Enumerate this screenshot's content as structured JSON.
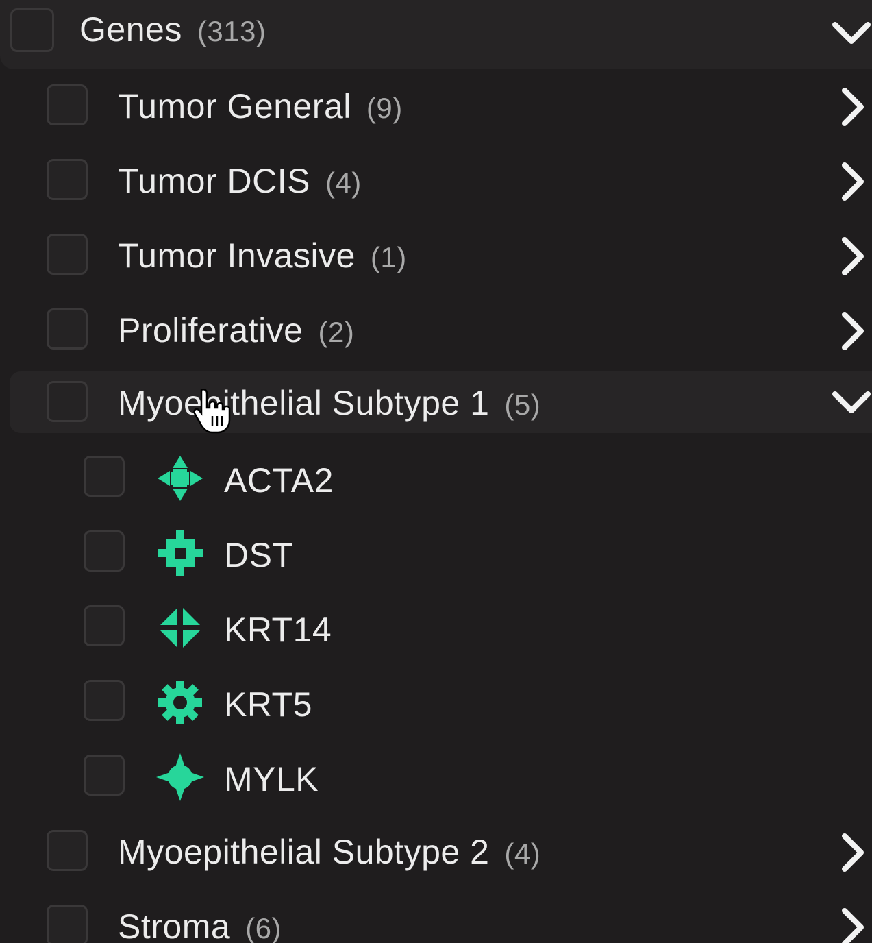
{
  "root": {
    "label": "Genes",
    "count": "(313)"
  },
  "groups": [
    {
      "label": "Tumor General",
      "count": "(9)"
    },
    {
      "label": "Tumor DCIS",
      "count": "(4)"
    },
    {
      "label": "Tumor Invasive",
      "count": "(1)"
    },
    {
      "label": "Proliferative",
      "count": "(2)"
    },
    {
      "label": "Myoepithelial Subtype 1",
      "count": "(5)"
    },
    {
      "label": "Myoepithelial Subtype 2",
      "count": "(4)"
    },
    {
      "label": "Stroma",
      "count": "(6)"
    }
  ],
  "genes": [
    {
      "label": "ACTA2",
      "icon": "four-arrows-marker-icon"
    },
    {
      "label": "DST",
      "icon": "square-cross-marker-icon"
    },
    {
      "label": "KRT14",
      "icon": "split-diamond-marker-icon"
    },
    {
      "label": "KRT5",
      "icon": "gear-marker-icon"
    },
    {
      "label": "MYLK",
      "icon": "four-point-star-marker-icon"
    }
  ],
  "colors": {
    "accent": "#27d69a",
    "background": "#1f1d1e"
  }
}
